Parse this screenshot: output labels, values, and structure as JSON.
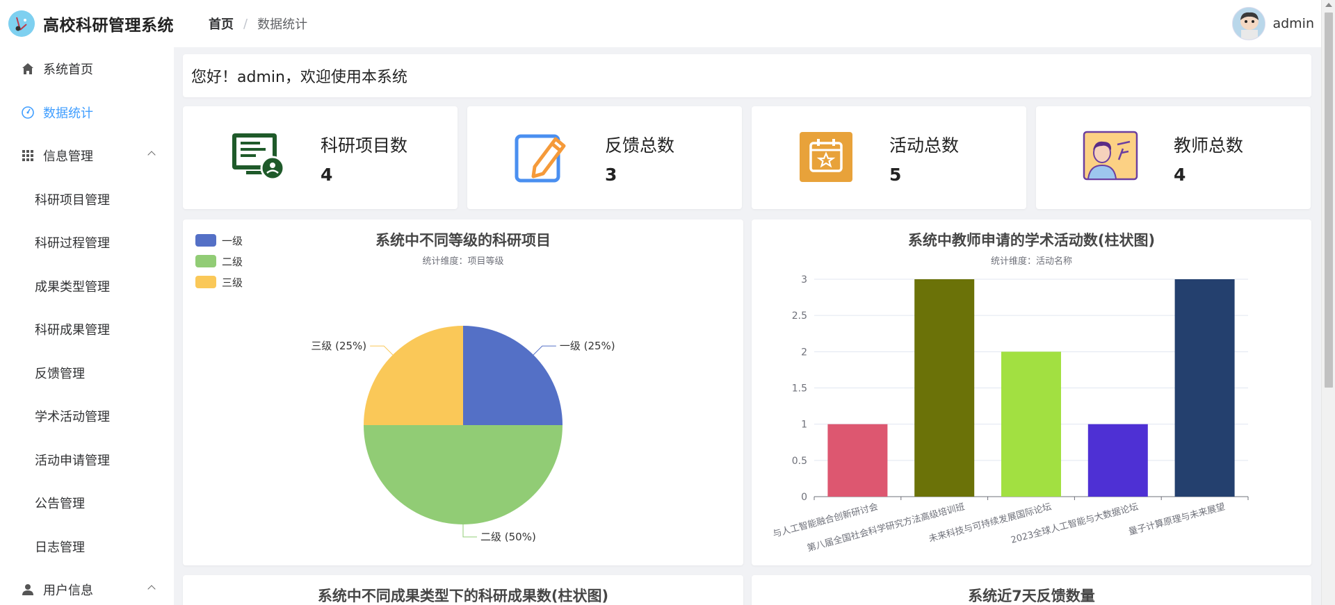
{
  "header": {
    "app_title": "高校科研管理系统",
    "breadcrumb_home": "首页",
    "breadcrumb_sep": "/",
    "breadcrumb_current": "数据统计",
    "username": "admin"
  },
  "sidebar": {
    "home": "系统首页",
    "stats": "数据统计",
    "info_group": "信息管理",
    "info_items": [
      "科研项目管理",
      "科研过程管理",
      "成果类型管理",
      "科研成果管理",
      "反馈管理",
      "学术活动管理",
      "活动申请管理",
      "公告管理",
      "日志管理"
    ],
    "user_group": "用户信息"
  },
  "welcome": "您好！admin，欢迎使用本系统",
  "stats": [
    {
      "label": "科研项目数",
      "value": "4",
      "icon": "monitor-user-icon"
    },
    {
      "label": "反馈总数",
      "value": "3",
      "icon": "edit-pencil-icon"
    },
    {
      "label": "活动总数",
      "value": "5",
      "icon": "calendar-star-icon"
    },
    {
      "label": "教师总数",
      "value": "4",
      "icon": "teacher-board-icon"
    }
  ],
  "colors": {
    "accent": "#409eff",
    "pie": [
      "#5470c6",
      "#91cc75",
      "#fac858"
    ],
    "bars": [
      "#dd5770",
      "#6b7208",
      "#a2e041",
      "#4e30d4",
      "#24406e"
    ]
  },
  "chart_data": [
    {
      "type": "pie",
      "title": "系统中不同等级的科研项目",
      "subtitle": "统计维度：项目等级",
      "legend": [
        "一级",
        "二级",
        "三级"
      ],
      "legend_position": "top-left",
      "slices": [
        {
          "name": "一级",
          "value": 1,
          "label": "一级 (25%)"
        },
        {
          "name": "二级",
          "value": 2,
          "label": "二级 (50%)"
        },
        {
          "name": "三级",
          "value": 1,
          "label": "三级 (25%)"
        }
      ]
    },
    {
      "type": "bar",
      "title": "系统中教师申请的学术活动数(柱状图)",
      "subtitle": "统计维度：活动名称",
      "categories": [
        "与人工智能融合创新研讨会",
        "第八届全国社会科学研究方法高级培训班",
        "未来科技与可持续发展国际论坛",
        "2023全球人工智能与大数据论坛",
        "量子计算原理与未来展望"
      ],
      "values": [
        1,
        3,
        2,
        1,
        3
      ],
      "ylim": [
        0,
        3
      ],
      "yticks": [
        "0",
        "0.5",
        "1",
        "1.5",
        "2",
        "2.5",
        "3"
      ],
      "grid": true
    }
  ],
  "bottom_titles": [
    "系统中不同成果类型下的科研成果数(柱状图)",
    "系统近7天反馈数量"
  ]
}
